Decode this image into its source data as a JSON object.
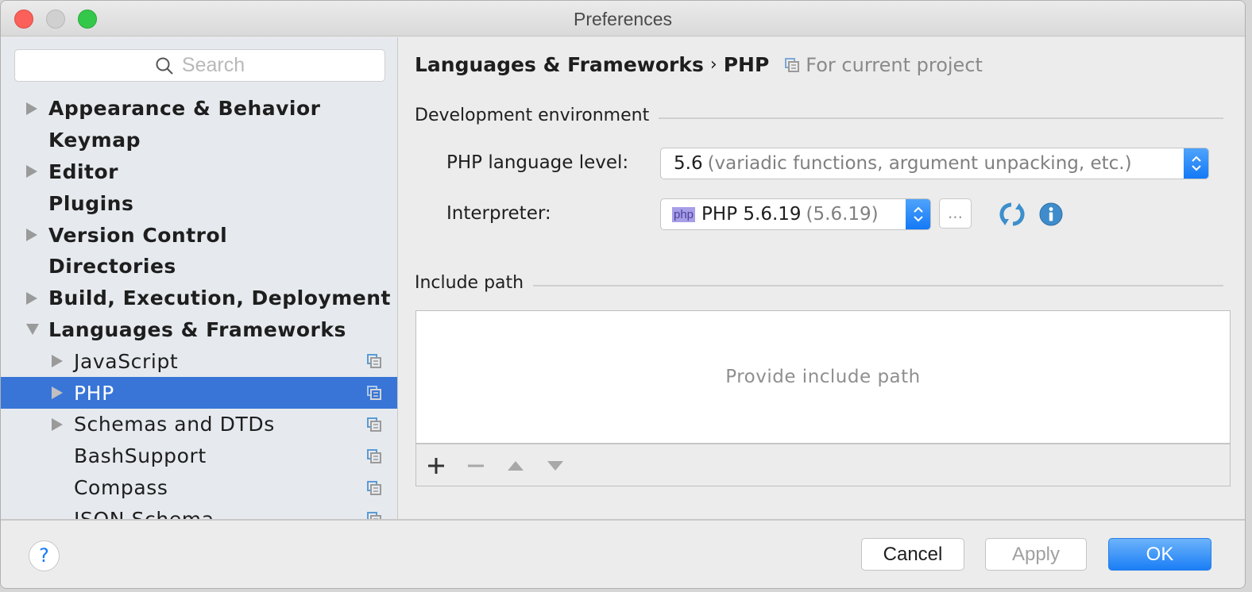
{
  "window": {
    "title": "Preferences"
  },
  "sidebar": {
    "search_placeholder": "Search",
    "items": [
      {
        "label": "Appearance & Behavior",
        "level": 0,
        "expander": "collapsed"
      },
      {
        "label": "Keymap",
        "level": 0,
        "expander": "none"
      },
      {
        "label": "Editor",
        "level": 0,
        "expander": "collapsed"
      },
      {
        "label": "Plugins",
        "level": 0,
        "expander": "none"
      },
      {
        "label": "Version Control",
        "level": 0,
        "expander": "collapsed"
      },
      {
        "label": "Directories",
        "level": 0,
        "expander": "none"
      },
      {
        "label": "Build, Execution, Deployment",
        "level": 0,
        "expander": "collapsed"
      },
      {
        "label": "Languages & Frameworks",
        "level": 0,
        "expander": "expanded"
      },
      {
        "label": "JavaScript",
        "level": 1,
        "expander": "collapsed",
        "project_icon": true
      },
      {
        "label": "PHP",
        "level": 1,
        "expander": "collapsed",
        "project_icon": true,
        "selected": true
      },
      {
        "label": "Schemas and DTDs",
        "level": 1,
        "expander": "collapsed",
        "project_icon": true
      },
      {
        "label": "BashSupport",
        "level": 1,
        "expander": "none",
        "project_icon": true
      },
      {
        "label": "Compass",
        "level": 1,
        "expander": "none",
        "project_icon": true
      },
      {
        "label": "JSON Schema",
        "level": 1,
        "expander": "none",
        "project_icon": true
      }
    ]
  },
  "main": {
    "breadcrumb": {
      "parent": "Languages & Frameworks",
      "separator": "›",
      "current": "PHP",
      "scope": "For current project"
    },
    "dev_env": {
      "section_title": "Development environment",
      "language_level_label": "PHP language level:",
      "language_level_value": "5.6",
      "language_level_hint": "(variadic functions, argument unpacking, etc.)",
      "interpreter_label": "Interpreter:",
      "interpreter_badge": "php",
      "interpreter_value": "PHP 5.6.19",
      "interpreter_hint": "(5.6.19)",
      "browse_label": "..."
    },
    "include_path": {
      "section_title": "Include path",
      "empty_text": "Provide include path",
      "tools": [
        "add",
        "remove",
        "move-up",
        "move-down"
      ]
    }
  },
  "footer": {
    "help_label": "?",
    "cancel_label": "Cancel",
    "apply_label": "Apply",
    "ok_label": "OK"
  },
  "colors": {
    "selection": "#3875d7",
    "accent": "#1479f6"
  }
}
